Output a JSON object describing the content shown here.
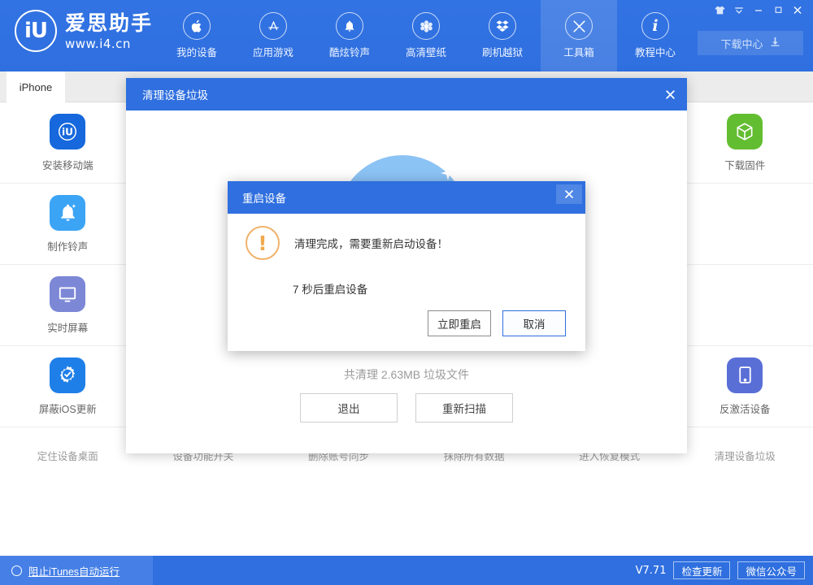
{
  "app": {
    "brand_name": "爱思助手",
    "brand_url": "www.i4.cn",
    "logo_text": "iU"
  },
  "header": {
    "nav": [
      {
        "label": "我的设备",
        "icon": "apple-icon",
        "active": false
      },
      {
        "label": "应用游戏",
        "icon": "appstore-icon",
        "active": false
      },
      {
        "label": "酷炫铃声",
        "icon": "bell-icon",
        "active": false
      },
      {
        "label": "高清壁纸",
        "icon": "flower-icon",
        "active": false
      },
      {
        "label": "刷机越狱",
        "icon": "dropbox-icon",
        "active": false
      },
      {
        "label": "工具箱",
        "icon": "tools-icon",
        "active": true
      },
      {
        "label": "教程中心",
        "icon": "info-icon",
        "active": false
      }
    ],
    "window_controls": [
      {
        "name": "skin-icon",
        "glyph": "♕"
      },
      {
        "name": "menu-icon",
        "glyph": "▼"
      },
      {
        "name": "minimize-icon",
        "glyph": "—"
      },
      {
        "name": "maximize-icon",
        "glyph": "□"
      },
      {
        "name": "close-icon",
        "glyph": "✕"
      }
    ],
    "download_center": {
      "label": "下载中心",
      "icon": "download-icon"
    }
  },
  "tabs": [
    {
      "label": "iPhone",
      "active": true
    }
  ],
  "tools": [
    {
      "label": "安装移动端",
      "icon": "i4-app-icon",
      "color": "#1668dc"
    },
    {
      "label": "",
      "icon": "",
      "color": ""
    },
    {
      "label": "",
      "icon": "",
      "color": ""
    },
    {
      "label": "",
      "icon": "",
      "color": ""
    },
    {
      "label": "",
      "icon": "",
      "color": ""
    },
    {
      "label": "下载固件",
      "icon": "box-icon",
      "color": "#63bd30"
    },
    {
      "label": "制作铃声",
      "icon": "bell-icon",
      "color": "#3ba4f5"
    },
    {
      "label": "",
      "icon": "",
      "color": ""
    },
    {
      "label": "",
      "icon": "",
      "color": ""
    },
    {
      "label": "",
      "icon": "",
      "color": ""
    },
    {
      "label": "",
      "icon": "",
      "color": ""
    },
    {
      "label": "",
      "icon": "",
      "color": ""
    },
    {
      "label": "实时屏幕",
      "icon": "monitor-icon",
      "color": "#7c87d6"
    },
    {
      "label": "",
      "icon": "",
      "color": ""
    },
    {
      "label": "",
      "icon": "",
      "color": ""
    },
    {
      "label": "",
      "icon": "",
      "color": ""
    },
    {
      "label": "",
      "icon": "",
      "color": ""
    },
    {
      "label": "",
      "icon": "",
      "color": ""
    },
    {
      "label": "屏蔽iOS更新",
      "icon": "gear-block-icon",
      "color": "#1f7fe8"
    },
    {
      "label": "",
      "icon": "",
      "color": ""
    },
    {
      "label": "",
      "icon": "",
      "color": ""
    },
    {
      "label": "",
      "icon": "",
      "color": ""
    },
    {
      "label": "",
      "icon": "",
      "color": ""
    },
    {
      "label": "反激活设备",
      "icon": "device-icon",
      "color": "#5a6fd6"
    }
  ],
  "tools_row_bottom": [
    "定住设备桌面",
    "设备功能开关",
    "删除账号同步",
    "抹除所有数据",
    "进入恢复模式",
    "清理设备垃圾"
  ],
  "clean_dialog": {
    "title": "清理设备垃圾",
    "close_label": "✕",
    "summary": "共清理 2.63MB 垃圾文件",
    "buttons": [
      {
        "label": "退出",
        "name": "exit-button"
      },
      {
        "label": "重新扫描",
        "name": "rescan-button"
      }
    ]
  },
  "restart_dialog": {
    "title": "重启设备",
    "close_label": "✕",
    "warn_glyph": "!",
    "message": "清理完成，需要重新启动设备！",
    "countdown": "7 秒后重启设备",
    "primary_button": "立即重启",
    "secondary_button": "取消"
  },
  "statusbar": {
    "block_itunes_label": "阻止iTunes自动运行",
    "version": "V7.71",
    "check_update": "检查更新",
    "wechat": "微信公众号"
  },
  "colors": {
    "brand_blue": "#2f6fdf",
    "header_blue": "#3273e3",
    "status_blue": "#2f6fdf",
    "warn_orange": "#f0a94e",
    "green": "#63bd30"
  }
}
